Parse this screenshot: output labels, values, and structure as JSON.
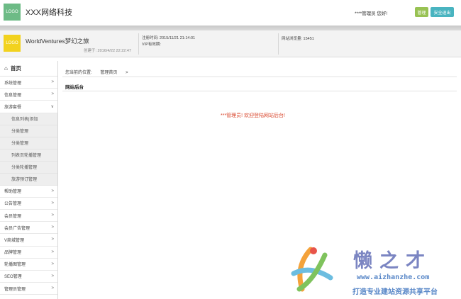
{
  "header": {
    "logo_text": "LOGO",
    "company": "XXX网络科技",
    "greeting": "****管理员 您好!",
    "manage_label": "管理",
    "logout_label": "安全退出",
    "logo_color": "#6dbb86",
    "manage_color": "#98c253",
    "logout_color": "#49b4c0"
  },
  "info": {
    "logo_text": "LOGO",
    "logo_color": "#f2d21e",
    "site_name": "WorldVentures梦幻之旅",
    "created": "创建于: 2016/4/22 22:22:47",
    "register_time": "注册时间:   2015/11/21 21:14:01",
    "vip": "VIP有效期:",
    "visits": "网站浏览量:   15451"
  },
  "sidebar": {
    "home_label": "首页",
    "home_icon": "home-icon",
    "items_top": [
      {
        "label": "系统管理",
        "chev": ">"
      },
      {
        "label": "信息管理",
        "chev": ">"
      },
      {
        "label": "旅游套餐",
        "chev": "∨"
      }
    ],
    "sub_items": [
      {
        "label": "信息列表|添加"
      },
      {
        "label": "分类管理"
      },
      {
        "label": "分类管理"
      },
      {
        "label": "列表页轮播管理"
      },
      {
        "label": "分类轮播管理"
      },
      {
        "label": "旅游预订管理"
      }
    ],
    "items_bottom": [
      {
        "label": "帮助管理",
        "chev": ">"
      },
      {
        "label": "公告管理",
        "chev": ">"
      },
      {
        "label": "会员管理",
        "chev": ">"
      },
      {
        "label": "会员广告管理",
        "chev": ">"
      },
      {
        "label": "V商城管理",
        "chev": ">"
      },
      {
        "label": "品牌管理",
        "chev": ">"
      },
      {
        "label": "轮播图管理",
        "chev": ">"
      },
      {
        "label": "SEO管理",
        "chev": ">"
      },
      {
        "label": "管理员管理",
        "chev": ">"
      }
    ]
  },
  "main": {
    "breadcrumb_label": "您当前的位置:",
    "breadcrumb_page": "管理首页",
    "breadcrumb_sep": ">",
    "panel_title": "网站后台",
    "welcome": "***管理员!  欢迎登陆网站后台!",
    "welcome_color": "#d9452b"
  },
  "watermark": {
    "brand": "懒之才",
    "url": "www.aizhanzhe.com",
    "tagline": "打造专业建站资源共享平台"
  }
}
